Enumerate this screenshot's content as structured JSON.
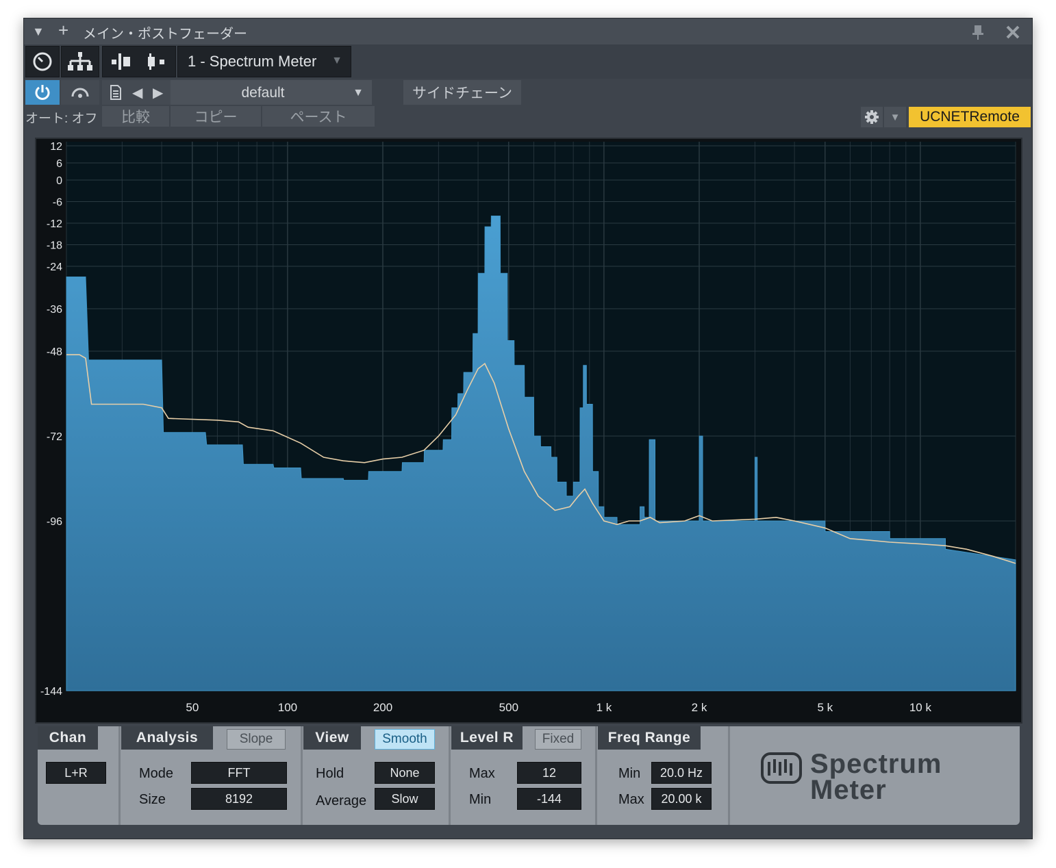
{
  "window": {
    "title": "メイン・ポストフェーダー",
    "device_name": "1 - Spectrum Meter",
    "preset": "default",
    "sidechain_label": "サイドチェーン",
    "auto_label": "オート: オフ",
    "compare_label": "比較",
    "copy_label": "コピー",
    "paste_label": "ペースト",
    "remote_label": "UCNETRemote",
    "icons": {
      "collapse": "triangle-down-icon",
      "add": "plus-icon",
      "pin": "pin-icon",
      "close": "close-icon",
      "clock": "clock-icon",
      "routing": "routing-icon",
      "power": "power-icon",
      "bypass": "bypass-arc-icon",
      "preset_file": "file-icon",
      "prev": "arrow-left-icon",
      "next": "arrow-right-icon",
      "gear": "gear-icon"
    }
  },
  "chart_data": {
    "type": "area",
    "x_scale": "log",
    "xlim": [
      20,
      20000
    ],
    "ylim": [
      -144,
      12
    ],
    "grid": true,
    "y_ticks": [
      12,
      6,
      0,
      -6,
      -12,
      -18,
      -24,
      -36,
      -48,
      -72,
      -96,
      -144
    ],
    "x_ticks": [
      {
        "v": 50,
        "l": "50"
      },
      {
        "v": 100,
        "l": "100"
      },
      {
        "v": 200,
        "l": "200"
      },
      {
        "v": 500,
        "l": "500"
      },
      {
        "v": 1000,
        "l": "1 k"
      },
      {
        "v": 2000,
        "l": "2 k"
      },
      {
        "v": 5000,
        "l": "5 k"
      },
      {
        "v": 10000,
        "l": "10 k"
      }
    ],
    "series": [
      {
        "kind": "bars",
        "color": "#4096c8",
        "points": [
          [
            20,
            -27
          ],
          [
            23,
            -27
          ],
          [
            23.5,
            -50.5
          ],
          [
            40,
            -50.5
          ],
          [
            40.5,
            -71
          ],
          [
            55,
            -71
          ],
          [
            55.5,
            -74.5
          ],
          [
            72,
            -74.5
          ],
          [
            72.5,
            -80
          ],
          [
            90,
            -80
          ],
          [
            90.5,
            -81
          ],
          [
            110,
            -81
          ],
          [
            110.5,
            -84
          ],
          [
            150,
            -84
          ],
          [
            150.5,
            -84.5
          ],
          [
            180,
            -84.5
          ],
          [
            180.5,
            -82
          ],
          [
            230,
            -82
          ],
          [
            230.5,
            -79.5
          ],
          [
            270,
            -79.5
          ],
          [
            270.5,
            -76
          ],
          [
            310,
            -76
          ],
          [
            310.5,
            -73
          ],
          [
            330,
            -73
          ],
          [
            330.5,
            -64
          ],
          [
            345,
            -64
          ],
          [
            345.5,
            -60
          ],
          [
            360,
            -60
          ],
          [
            360.5,
            -54
          ],
          [
            385,
            -54
          ],
          [
            385.5,
            -43
          ],
          [
            400,
            -43
          ],
          [
            400.5,
            -26
          ],
          [
            420,
            -26
          ],
          [
            420.5,
            -13
          ],
          [
            440,
            -13
          ],
          [
            440.5,
            -10
          ],
          [
            470,
            -10
          ],
          [
            470.5,
            -26
          ],
          [
            495,
            -26
          ],
          [
            495.5,
            -45
          ],
          [
            520,
            -45
          ],
          [
            520.5,
            -52
          ],
          [
            560,
            -52
          ],
          [
            560.5,
            -61
          ],
          [
            600,
            -61
          ],
          [
            600.5,
            -72
          ],
          [
            630,
            -72
          ],
          [
            630.5,
            -75
          ],
          [
            680,
            -75
          ],
          [
            680.5,
            -78
          ],
          [
            710,
            -78
          ],
          [
            710.5,
            -85
          ],
          [
            760,
            -85
          ],
          [
            760.5,
            -89
          ],
          [
            800,
            -89
          ],
          [
            800.5,
            -85
          ],
          [
            840,
            -85
          ],
          [
            840.5,
            -64
          ],
          [
            860,
            -64
          ],
          [
            860.5,
            -52
          ],
          [
            880,
            -52
          ],
          [
            880.5,
            -63
          ],
          [
            920,
            -63
          ],
          [
            920.5,
            -82
          ],
          [
            960,
            -82
          ],
          [
            960.5,
            -92
          ],
          [
            1000,
            -92
          ],
          [
            1000.5,
            -95
          ],
          [
            1100,
            -95
          ],
          [
            1100.5,
            -97
          ],
          [
            1300,
            -97
          ],
          [
            1300.5,
            -92
          ],
          [
            1340,
            -92
          ],
          [
            1340.5,
            -95
          ],
          [
            1390,
            -95
          ],
          [
            1390.5,
            -73
          ],
          [
            1450,
            -73
          ],
          [
            1450.5,
            -96
          ],
          [
            2000,
            -96
          ],
          [
            2000.5,
            -72
          ],
          [
            2050,
            -72
          ],
          [
            2050.5,
            -96
          ],
          [
            3000,
            -96
          ],
          [
            3000.5,
            -78
          ],
          [
            3050,
            -78
          ],
          [
            3050.5,
            -96
          ],
          [
            5000,
            -96
          ],
          [
            5000.5,
            -99
          ],
          [
            8000,
            -99
          ],
          [
            8000.5,
            -101
          ],
          [
            12000,
            -101
          ],
          [
            12000.5,
            -104
          ],
          [
            20000,
            -107
          ]
        ]
      },
      {
        "kind": "line",
        "color": "#e8cfa8",
        "points": [
          [
            20,
            -49
          ],
          [
            22,
            -49
          ],
          [
            23,
            -50
          ],
          [
            24,
            -63
          ],
          [
            35,
            -63
          ],
          [
            40,
            -64
          ],
          [
            42,
            -67
          ],
          [
            60,
            -67.5
          ],
          [
            70,
            -68
          ],
          [
            75,
            -69.5
          ],
          [
            90,
            -70.5
          ],
          [
            110,
            -74
          ],
          [
            130,
            -78
          ],
          [
            150,
            -79
          ],
          [
            175,
            -79.5
          ],
          [
            200,
            -78.5
          ],
          [
            230,
            -78
          ],
          [
            270,
            -76
          ],
          [
            300,
            -72
          ],
          [
            340,
            -66
          ],
          [
            370,
            -59
          ],
          [
            400,
            -53
          ],
          [
            420,
            -51.5
          ],
          [
            450,
            -57
          ],
          [
            500,
            -70
          ],
          [
            560,
            -82
          ],
          [
            620,
            -89
          ],
          [
            700,
            -93
          ],
          [
            780,
            -92
          ],
          [
            830,
            -89
          ],
          [
            870,
            -87
          ],
          [
            920,
            -91
          ],
          [
            1000,
            -96
          ],
          [
            1100,
            -97
          ],
          [
            1200,
            -96
          ],
          [
            1300,
            -96
          ],
          [
            1400,
            -95
          ],
          [
            1500,
            -96.5
          ],
          [
            1800,
            -96
          ],
          [
            2000,
            -94.5
          ],
          [
            2200,
            -96
          ],
          [
            3000,
            -95.5
          ],
          [
            3500,
            -95
          ],
          [
            4000,
            -96
          ],
          [
            5000,
            -98
          ],
          [
            6000,
            -101
          ],
          [
            7000,
            -101.5
          ],
          [
            8000,
            -102
          ],
          [
            10000,
            -102.5
          ],
          [
            12000,
            -103
          ],
          [
            14000,
            -104
          ],
          [
            17000,
            -106
          ],
          [
            20000,
            -108
          ]
        ]
      }
    ]
  },
  "controls": {
    "chan": {
      "tab": "Chan",
      "value": "L+R"
    },
    "analysis": {
      "tab": "Analysis",
      "toggle": "Slope",
      "mode_label": "Mode",
      "mode_value": "FFT",
      "size_label": "Size",
      "size_value": "8192"
    },
    "view": {
      "tab": "View",
      "toggle": "Smooth",
      "hold_label": "Hold",
      "hold_value": "None",
      "average_label": "Average",
      "average_value": "Slow"
    },
    "level": {
      "tab": "Level R",
      "toggle": "Fixed",
      "max_label": "Max",
      "max_value": "12",
      "min_label": "Min",
      "min_value": "-144"
    },
    "freq": {
      "tab": "Freq Range",
      "min_label": "Min",
      "min_value": "20.0 Hz",
      "max_label": "Max",
      "max_value": "20.00 k"
    },
    "logo": {
      "line1": "Spectrum",
      "line2": "Meter"
    }
  }
}
